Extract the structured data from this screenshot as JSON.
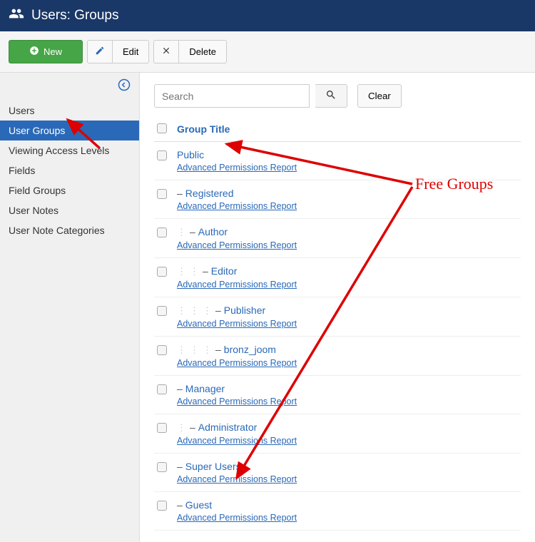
{
  "header": {
    "title": "Users: Groups"
  },
  "toolbar": {
    "new_label": "New",
    "edit_label": "Edit",
    "delete_label": "Delete"
  },
  "sidebar": {
    "items": [
      {
        "label": "Users",
        "active": false
      },
      {
        "label": "User Groups",
        "active": true
      },
      {
        "label": "Viewing Access Levels",
        "active": false
      },
      {
        "label": "Fields",
        "active": false
      },
      {
        "label": "Field Groups",
        "active": false
      },
      {
        "label": "User Notes",
        "active": false
      },
      {
        "label": "User Note Categories",
        "active": false
      }
    ]
  },
  "search": {
    "placeholder": "Search",
    "clear_label": "Clear"
  },
  "table": {
    "column_title": "Group Title",
    "sublink_label": "Advanced Permissions Report",
    "rows": [
      {
        "title": "Public",
        "level": 0
      },
      {
        "title": "Registered",
        "level": 1
      },
      {
        "title": "Author",
        "level": 2
      },
      {
        "title": "Editor",
        "level": 3
      },
      {
        "title": "Publisher",
        "level": 4
      },
      {
        "title": "bronz_joom",
        "level": 4
      },
      {
        "title": "Manager",
        "level": 1
      },
      {
        "title": "Administrator",
        "level": 2
      },
      {
        "title": "Super Users",
        "level": 1
      },
      {
        "title": "Guest",
        "level": 1
      }
    ]
  },
  "annotation": {
    "text": "Free Groups"
  }
}
